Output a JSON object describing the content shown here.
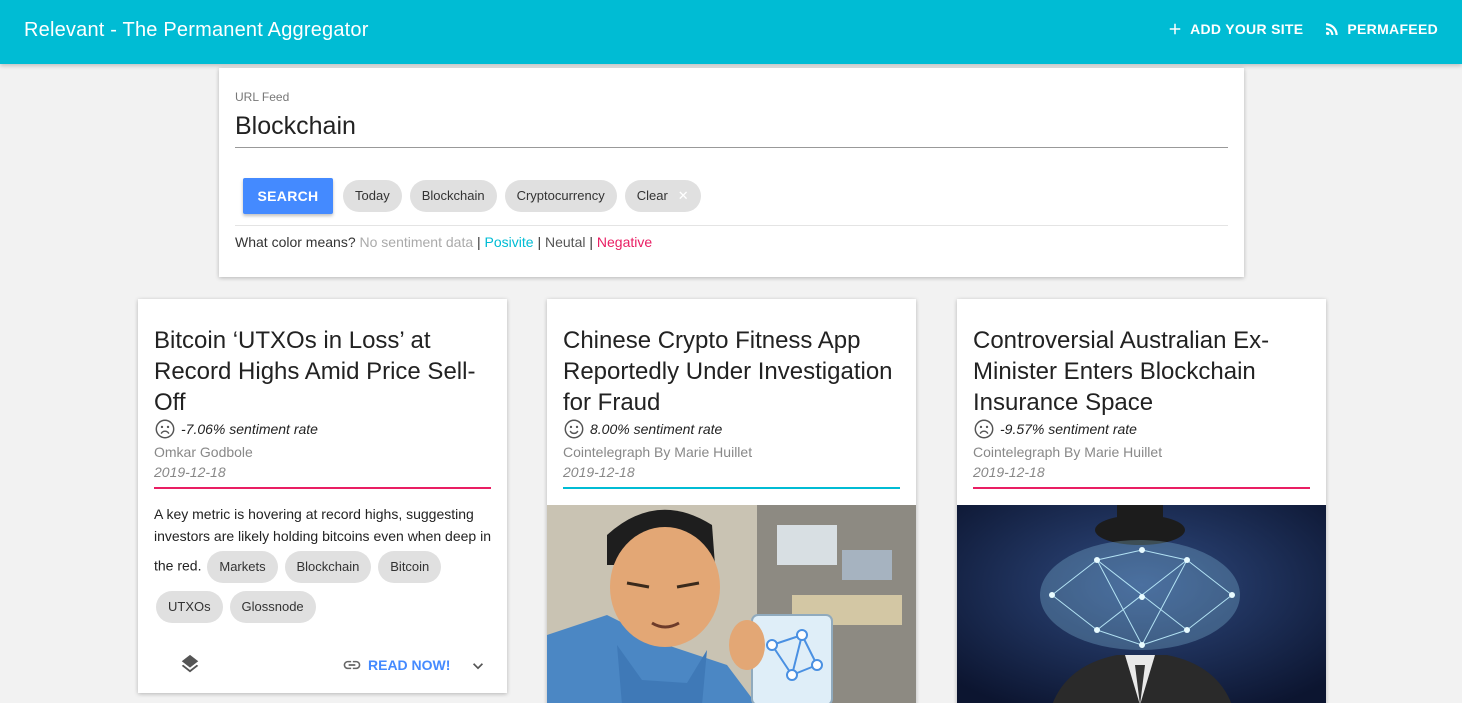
{
  "app": {
    "title": "Relevant - The Permanent Aggregator",
    "actions": [
      {
        "label": "ADD YOUR SITE",
        "icon": "plus-icon"
      },
      {
        "label": "PERMAFEED",
        "icon": "rss-icon"
      }
    ]
  },
  "search": {
    "field_label": "URL Feed",
    "value": "Blockchain",
    "button_label": "SEARCH",
    "chips": [
      "Today",
      "Blockchain",
      "Cryptocurrency"
    ],
    "clear_chip": "Clear",
    "clear_icon": "close-icon"
  },
  "legend": {
    "prefix": "What color means?",
    "none": "No sentiment data",
    "positive": "Posivite",
    "neutral": "Neutal",
    "negative": "Negative",
    "separator": "|"
  },
  "colors": {
    "primary": "#00bcd4",
    "accent": "#448aff",
    "positive": "#00bcd4",
    "negative": "#e91e63",
    "none": "#aaaaaa"
  },
  "cards": [
    {
      "title": "Bitcoin ‘UTXOs in Loss’ at Record Highs Amid Price Sell-Off",
      "sentiment_icon": "sad-face-icon",
      "sentiment": "-7.06% sentiment rate",
      "author": "Omkar Godbole",
      "date": "2019-12-18",
      "description": "A key metric is hovering at record highs, suggesting investors are likely holding bitcoins even when deep in the red.",
      "tags": [
        "Markets",
        "Blockchain",
        "Bitcoin",
        "UTXOs",
        "Glossnode"
      ],
      "read_label": "READ NOW!",
      "read_icon": "link-icon",
      "layers_icon": "layers-icon",
      "expand_icon": "chevron-down-icon"
    },
    {
      "title": "Chinese Crypto Fitness App Reportedly Under Investigation for Fraud",
      "sentiment_icon": "smile-face-icon",
      "sentiment": "8.00% sentiment rate",
      "author": "Cointelegraph By Marie Huillet",
      "date": "2019-12-18",
      "image": "illustration-man-holding-bag-of-network-nodes"
    },
    {
      "title": "Controversial Australian Ex-Minister Enters Blockchain Insurance Space",
      "sentiment_icon": "sad-face-icon",
      "sentiment": "-9.57% sentiment rate",
      "author": "Cointelegraph By Marie Huillet",
      "date": "2019-12-18",
      "image": "illustration-bowler-hat-network-head-in-suit"
    }
  ]
}
